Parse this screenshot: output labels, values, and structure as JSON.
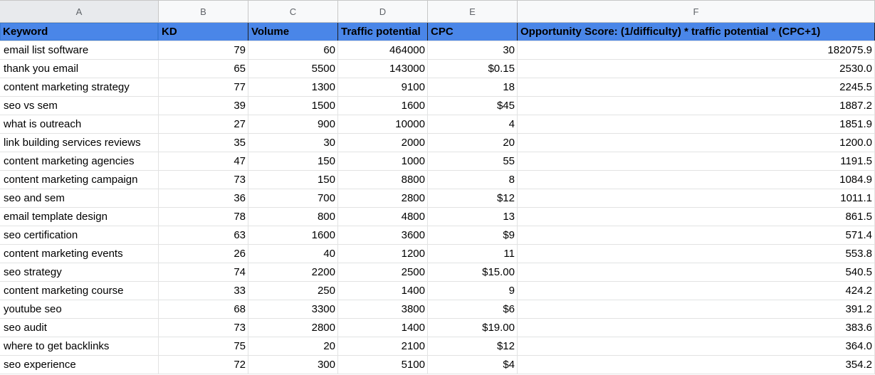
{
  "column_letters": [
    "A",
    "B",
    "C",
    "D",
    "E",
    "F"
  ],
  "headers": {
    "keyword": "Keyword",
    "kd": "KD",
    "volume": "Volume",
    "traffic": "Traffic potential",
    "cpc": "CPC",
    "score": "Opportunity Score: (1/difficulty) * traffic potential * (CPC+1)"
  },
  "colors": {
    "header_fill": "#4a86e8",
    "gridline": "#e2e3e3"
  },
  "rows": [
    {
      "keyword": "email list software",
      "kd": "79",
      "volume": "60",
      "traffic": "464000",
      "cpc": "30",
      "score": "182075.9"
    },
    {
      "keyword": "thank you email",
      "kd": "65",
      "volume": "5500",
      "traffic": "143000",
      "cpc": "$0.15",
      "score": "2530.0"
    },
    {
      "keyword": "content marketing strategy",
      "kd": "77",
      "volume": "1300",
      "traffic": "9100",
      "cpc": "18",
      "score": "2245.5"
    },
    {
      "keyword": "seo vs sem",
      "kd": "39",
      "volume": "1500",
      "traffic": "1600",
      "cpc": "$45",
      "score": "1887.2"
    },
    {
      "keyword": "what is outreach",
      "kd": "27",
      "volume": "900",
      "traffic": "10000",
      "cpc": "4",
      "score": "1851.9"
    },
    {
      "keyword": "link building services reviews",
      "kd": "35",
      "volume": "30",
      "traffic": "2000",
      "cpc": "20",
      "score": "1200.0"
    },
    {
      "keyword": "content marketing agencies",
      "kd": "47",
      "volume": "150",
      "traffic": "1000",
      "cpc": "55",
      "score": "1191.5"
    },
    {
      "keyword": "content marketing campaign",
      "kd": "73",
      "volume": "150",
      "traffic": "8800",
      "cpc": "8",
      "score": "1084.9"
    },
    {
      "keyword": "seo and sem",
      "kd": "36",
      "volume": "700",
      "traffic": "2800",
      "cpc": "$12",
      "score": "1011.1"
    },
    {
      "keyword": "email template design",
      "kd": "78",
      "volume": "800",
      "traffic": "4800",
      "cpc": "13",
      "score": "861.5"
    },
    {
      "keyword": "seo certification",
      "kd": "63",
      "volume": "1600",
      "traffic": "3600",
      "cpc": "$9",
      "score": "571.4"
    },
    {
      "keyword": "content marketing events",
      "kd": "26",
      "volume": "40",
      "traffic": "1200",
      "cpc": "11",
      "score": "553.8"
    },
    {
      "keyword": "seo strategy",
      "kd": "74",
      "volume": "2200",
      "traffic": "2500",
      "cpc": "$15.00",
      "score": "540.5"
    },
    {
      "keyword": "content marketing course",
      "kd": "33",
      "volume": "250",
      "traffic": "1400",
      "cpc": "9",
      "score": "424.2"
    },
    {
      "keyword": "youtube seo",
      "kd": "68",
      "volume": "3300",
      "traffic": "3800",
      "cpc": "$6",
      "score": "391.2"
    },
    {
      "keyword": "seo audit",
      "kd": "73",
      "volume": "2800",
      "traffic": "1400",
      "cpc": "$19.00",
      "score": "383.6"
    },
    {
      "keyword": "where to get backlinks",
      "kd": "75",
      "volume": "20",
      "traffic": "2100",
      "cpc": "$12",
      "score": "364.0"
    },
    {
      "keyword": "seo experience",
      "kd": "72",
      "volume": "300",
      "traffic": "5100",
      "cpc": "$4",
      "score": "354.2"
    }
  ]
}
